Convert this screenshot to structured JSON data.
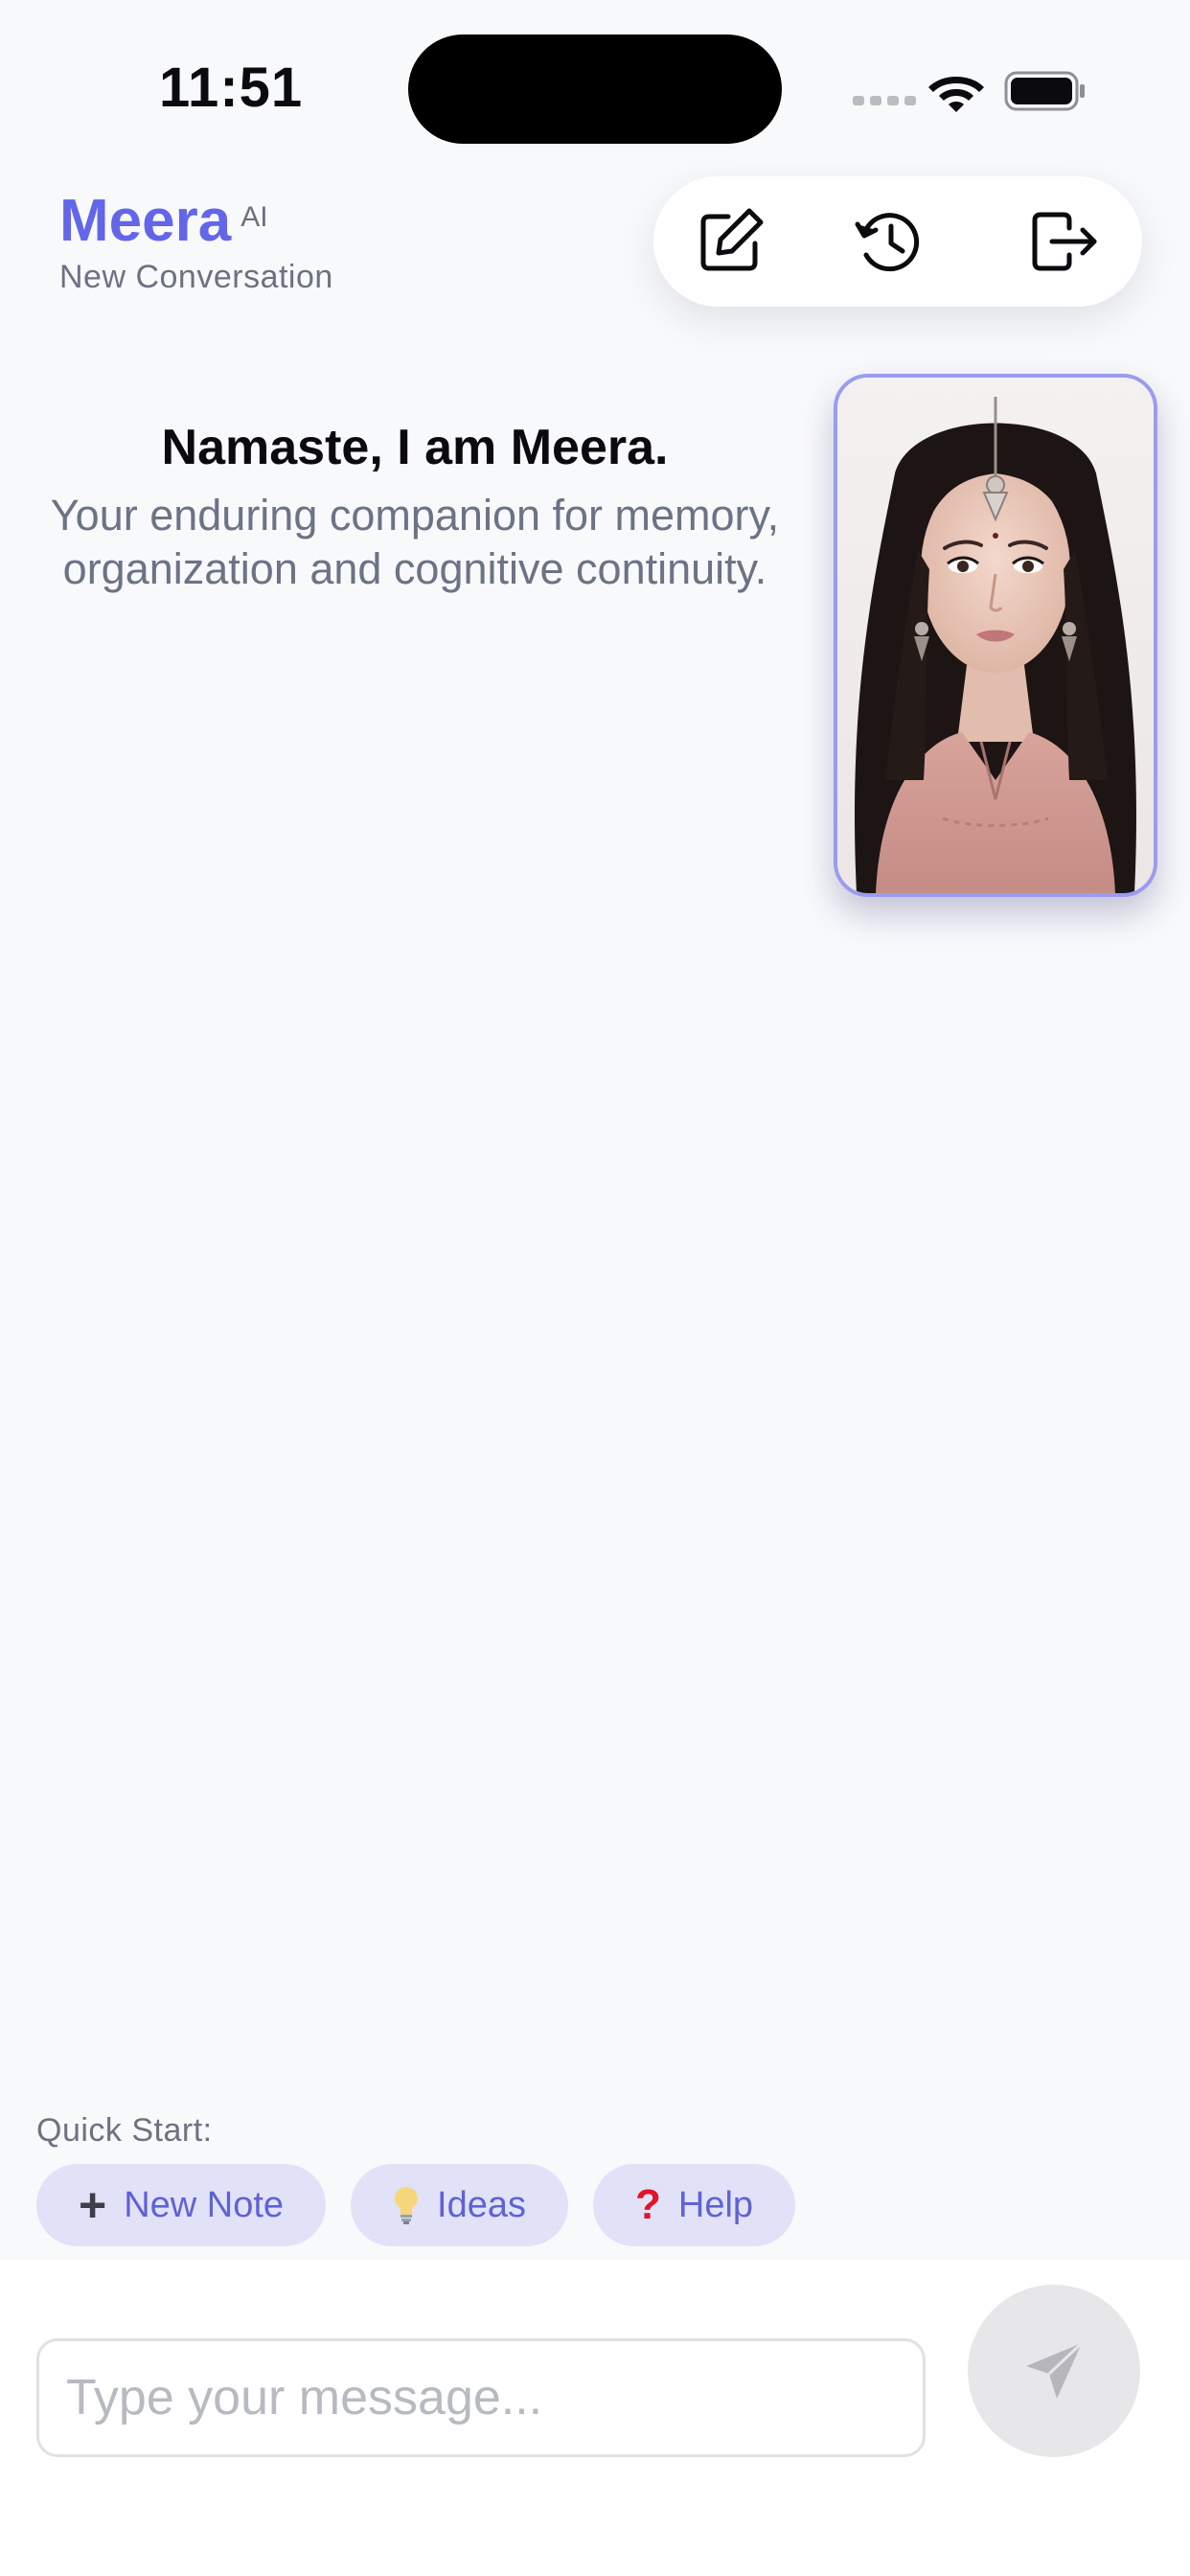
{
  "status_bar": {
    "time": "11:51"
  },
  "header": {
    "brand": "Meera",
    "brand_badge": "AI",
    "subtitle": "New Conversation",
    "toolbar_icons": [
      "edit-icon",
      "history-icon",
      "logout-icon"
    ]
  },
  "greeting": {
    "title": "Namaste, I am Meera.",
    "subtitle": "Your enduring companion for memory, organization and cognitive continuity."
  },
  "quick_start": {
    "label": "Quick Start:",
    "chips": [
      {
        "icon": "plus-icon",
        "label": "New Note"
      },
      {
        "icon": "lightbulb-icon",
        "label": "Ideas"
      },
      {
        "icon": "question-icon",
        "label": "Help"
      }
    ]
  },
  "composer": {
    "placeholder": "Type your message...",
    "send_icon": "send-icon"
  },
  "colors": {
    "accent": "#6366e8",
    "background": "#f8f9fb",
    "chip_background": "#e1e2f8",
    "avatar_border": "#9a9cf0"
  }
}
